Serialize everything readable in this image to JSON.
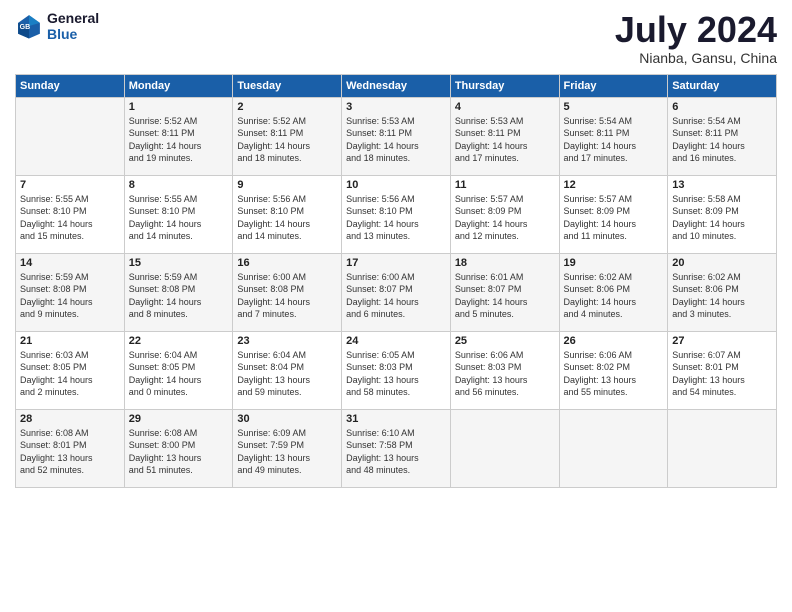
{
  "header": {
    "logo_line1": "General",
    "logo_line2": "Blue",
    "title": "July 2024",
    "subtitle": "Nianba, Gansu, China"
  },
  "days_of_week": [
    "Sunday",
    "Monday",
    "Tuesday",
    "Wednesday",
    "Thursday",
    "Friday",
    "Saturday"
  ],
  "weeks": [
    [
      {
        "day": "",
        "info": ""
      },
      {
        "day": "1",
        "info": "Sunrise: 5:52 AM\nSunset: 8:11 PM\nDaylight: 14 hours\nand 19 minutes."
      },
      {
        "day": "2",
        "info": "Sunrise: 5:52 AM\nSunset: 8:11 PM\nDaylight: 14 hours\nand 18 minutes."
      },
      {
        "day": "3",
        "info": "Sunrise: 5:53 AM\nSunset: 8:11 PM\nDaylight: 14 hours\nand 18 minutes."
      },
      {
        "day": "4",
        "info": "Sunrise: 5:53 AM\nSunset: 8:11 PM\nDaylight: 14 hours\nand 17 minutes."
      },
      {
        "day": "5",
        "info": "Sunrise: 5:54 AM\nSunset: 8:11 PM\nDaylight: 14 hours\nand 17 minutes."
      },
      {
        "day": "6",
        "info": "Sunrise: 5:54 AM\nSunset: 8:11 PM\nDaylight: 14 hours\nand 16 minutes."
      }
    ],
    [
      {
        "day": "7",
        "info": "Sunrise: 5:55 AM\nSunset: 8:10 PM\nDaylight: 14 hours\nand 15 minutes."
      },
      {
        "day": "8",
        "info": "Sunrise: 5:55 AM\nSunset: 8:10 PM\nDaylight: 14 hours\nand 14 minutes."
      },
      {
        "day": "9",
        "info": "Sunrise: 5:56 AM\nSunset: 8:10 PM\nDaylight: 14 hours\nand 14 minutes."
      },
      {
        "day": "10",
        "info": "Sunrise: 5:56 AM\nSunset: 8:10 PM\nDaylight: 14 hours\nand 13 minutes."
      },
      {
        "day": "11",
        "info": "Sunrise: 5:57 AM\nSunset: 8:09 PM\nDaylight: 14 hours\nand 12 minutes."
      },
      {
        "day": "12",
        "info": "Sunrise: 5:57 AM\nSunset: 8:09 PM\nDaylight: 14 hours\nand 11 minutes."
      },
      {
        "day": "13",
        "info": "Sunrise: 5:58 AM\nSunset: 8:09 PM\nDaylight: 14 hours\nand 10 minutes."
      }
    ],
    [
      {
        "day": "14",
        "info": "Sunrise: 5:59 AM\nSunset: 8:08 PM\nDaylight: 14 hours\nand 9 minutes."
      },
      {
        "day": "15",
        "info": "Sunrise: 5:59 AM\nSunset: 8:08 PM\nDaylight: 14 hours\nand 8 minutes."
      },
      {
        "day": "16",
        "info": "Sunrise: 6:00 AM\nSunset: 8:08 PM\nDaylight: 14 hours\nand 7 minutes."
      },
      {
        "day": "17",
        "info": "Sunrise: 6:00 AM\nSunset: 8:07 PM\nDaylight: 14 hours\nand 6 minutes."
      },
      {
        "day": "18",
        "info": "Sunrise: 6:01 AM\nSunset: 8:07 PM\nDaylight: 14 hours\nand 5 minutes."
      },
      {
        "day": "19",
        "info": "Sunrise: 6:02 AM\nSunset: 8:06 PM\nDaylight: 14 hours\nand 4 minutes."
      },
      {
        "day": "20",
        "info": "Sunrise: 6:02 AM\nSunset: 8:06 PM\nDaylight: 14 hours\nand 3 minutes."
      }
    ],
    [
      {
        "day": "21",
        "info": "Sunrise: 6:03 AM\nSunset: 8:05 PM\nDaylight: 14 hours\nand 2 minutes."
      },
      {
        "day": "22",
        "info": "Sunrise: 6:04 AM\nSunset: 8:05 PM\nDaylight: 14 hours\nand 0 minutes."
      },
      {
        "day": "23",
        "info": "Sunrise: 6:04 AM\nSunset: 8:04 PM\nDaylight: 13 hours\nand 59 minutes."
      },
      {
        "day": "24",
        "info": "Sunrise: 6:05 AM\nSunset: 8:03 PM\nDaylight: 13 hours\nand 58 minutes."
      },
      {
        "day": "25",
        "info": "Sunrise: 6:06 AM\nSunset: 8:03 PM\nDaylight: 13 hours\nand 56 minutes."
      },
      {
        "day": "26",
        "info": "Sunrise: 6:06 AM\nSunset: 8:02 PM\nDaylight: 13 hours\nand 55 minutes."
      },
      {
        "day": "27",
        "info": "Sunrise: 6:07 AM\nSunset: 8:01 PM\nDaylight: 13 hours\nand 54 minutes."
      }
    ],
    [
      {
        "day": "28",
        "info": "Sunrise: 6:08 AM\nSunset: 8:01 PM\nDaylight: 13 hours\nand 52 minutes."
      },
      {
        "day": "29",
        "info": "Sunrise: 6:08 AM\nSunset: 8:00 PM\nDaylight: 13 hours\nand 51 minutes."
      },
      {
        "day": "30",
        "info": "Sunrise: 6:09 AM\nSunset: 7:59 PM\nDaylight: 13 hours\nand 49 minutes."
      },
      {
        "day": "31",
        "info": "Sunrise: 6:10 AM\nSunset: 7:58 PM\nDaylight: 13 hours\nand 48 minutes."
      },
      {
        "day": "",
        "info": ""
      },
      {
        "day": "",
        "info": ""
      },
      {
        "day": "",
        "info": ""
      }
    ]
  ]
}
